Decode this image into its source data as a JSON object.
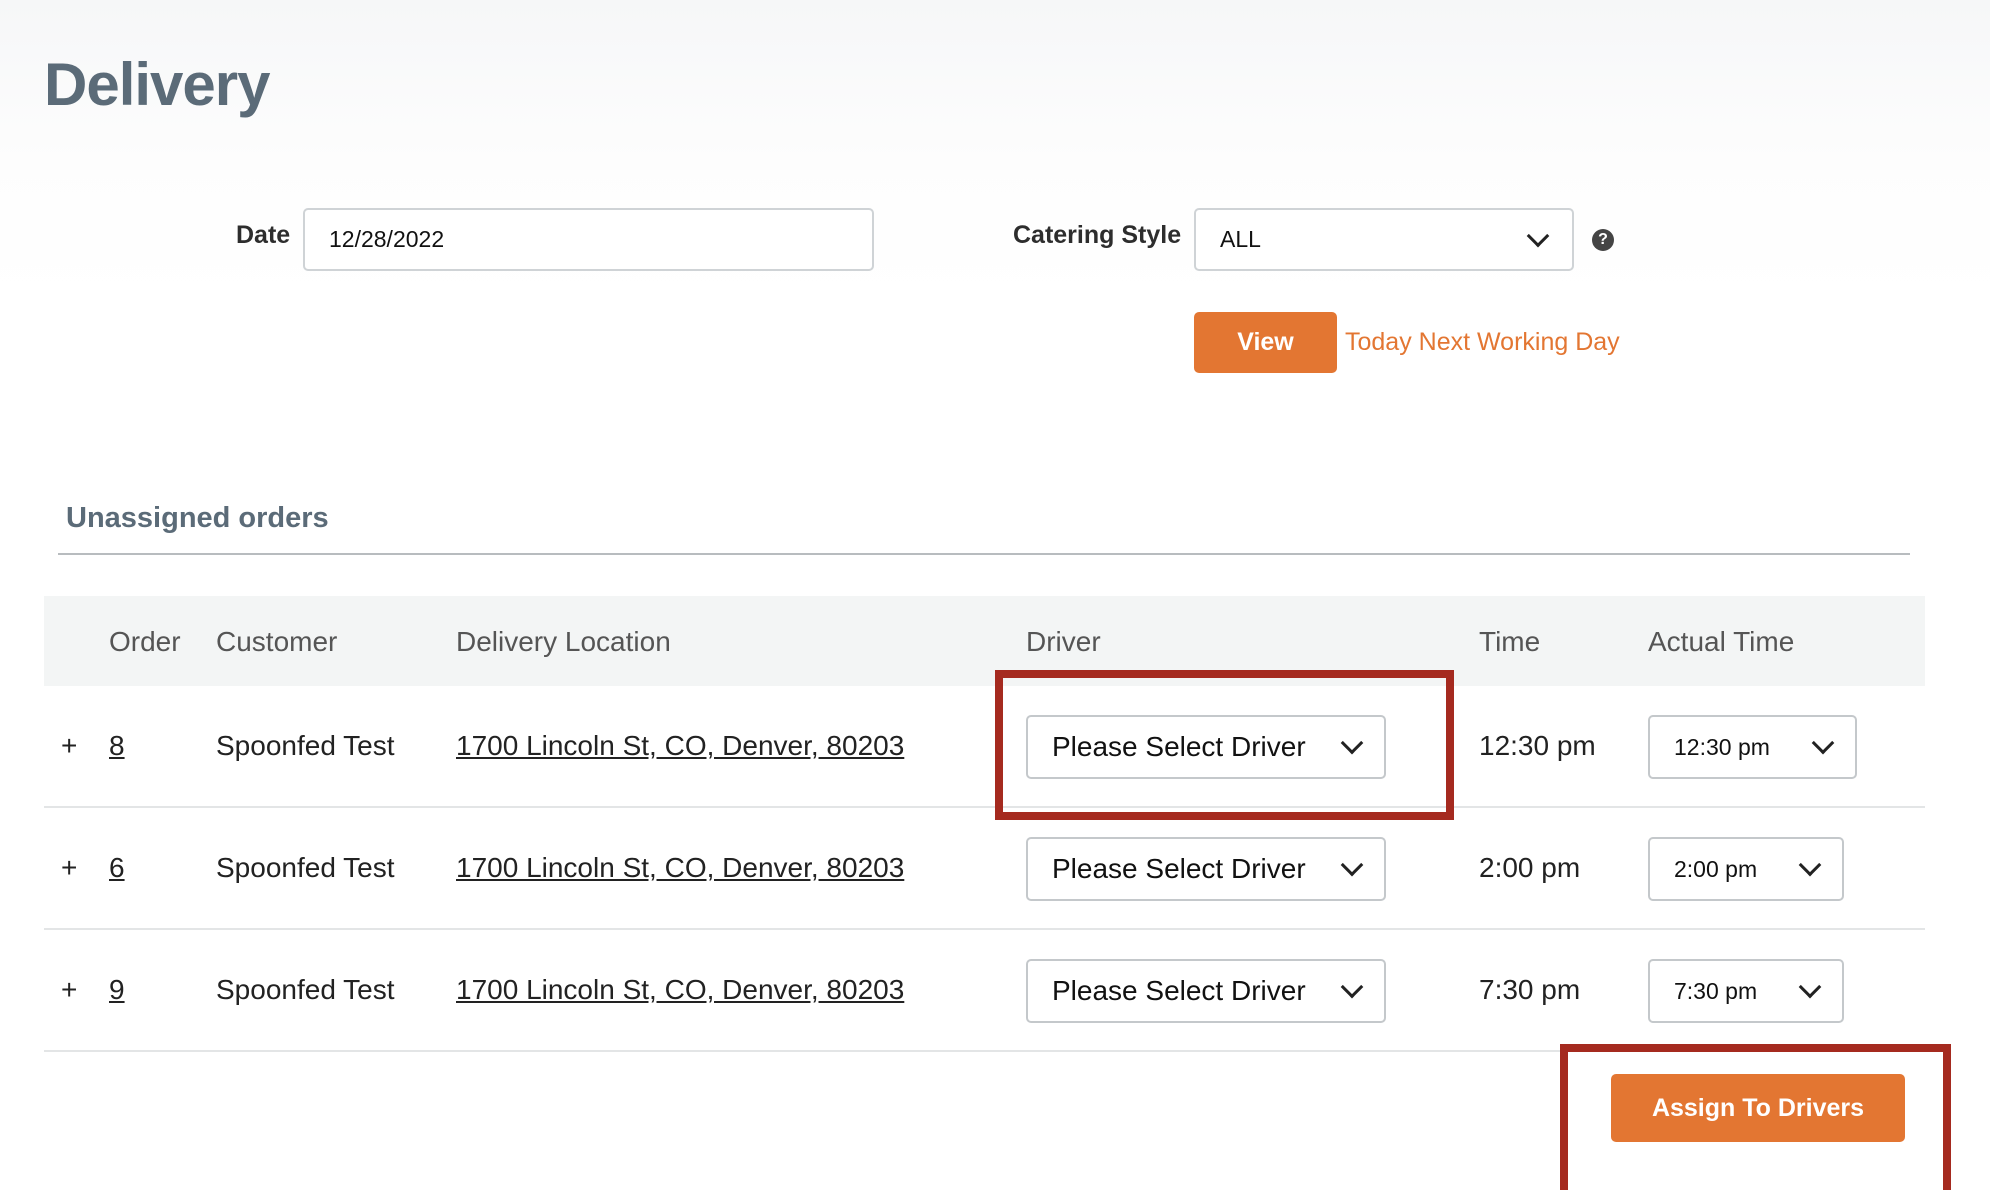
{
  "page": {
    "title": "Delivery"
  },
  "filters": {
    "date_label": "Date",
    "date_value": "12/28/2022",
    "catering_label": "Catering Style",
    "catering_value": "ALL",
    "view_label": "View",
    "today_link": "Today",
    "next_working_day_link": "Next Working Day"
  },
  "unassigned": {
    "title": "Unassigned orders",
    "columns": [
      "Order",
      "Customer",
      "Delivery Location",
      "Driver",
      "Time",
      "Actual Time"
    ],
    "rows": [
      {
        "expand": "+",
        "order": "8",
        "customer": "Spoonfed Test",
        "location": "1700 Lincoln St, CO, Denver, 80203",
        "driver": "Please Select Driver",
        "time": "12:30 pm",
        "actual_time": "12:30 pm"
      },
      {
        "expand": "+",
        "order": "6",
        "customer": "Spoonfed Test",
        "location": "1700 Lincoln St, CO, Denver, 80203",
        "driver": "Please Select Driver",
        "time": "2:00 pm",
        "actual_time": "2:00 pm"
      },
      {
        "expand": "+",
        "order": "9",
        "customer": "Spoonfed Test",
        "location": "1700 Lincoln St, CO, Denver, 80203",
        "driver": "Please Select Driver",
        "time": "7:30 pm",
        "actual_time": "7:30 pm"
      }
    ],
    "assign_label": "Assign To Drivers"
  },
  "colors": {
    "accent": "#e37632",
    "title": "#5b6b78",
    "highlight": "#a52a1f"
  },
  "icons": {
    "dropdown": "chevron-down-icon",
    "help": "question-circle-icon"
  }
}
